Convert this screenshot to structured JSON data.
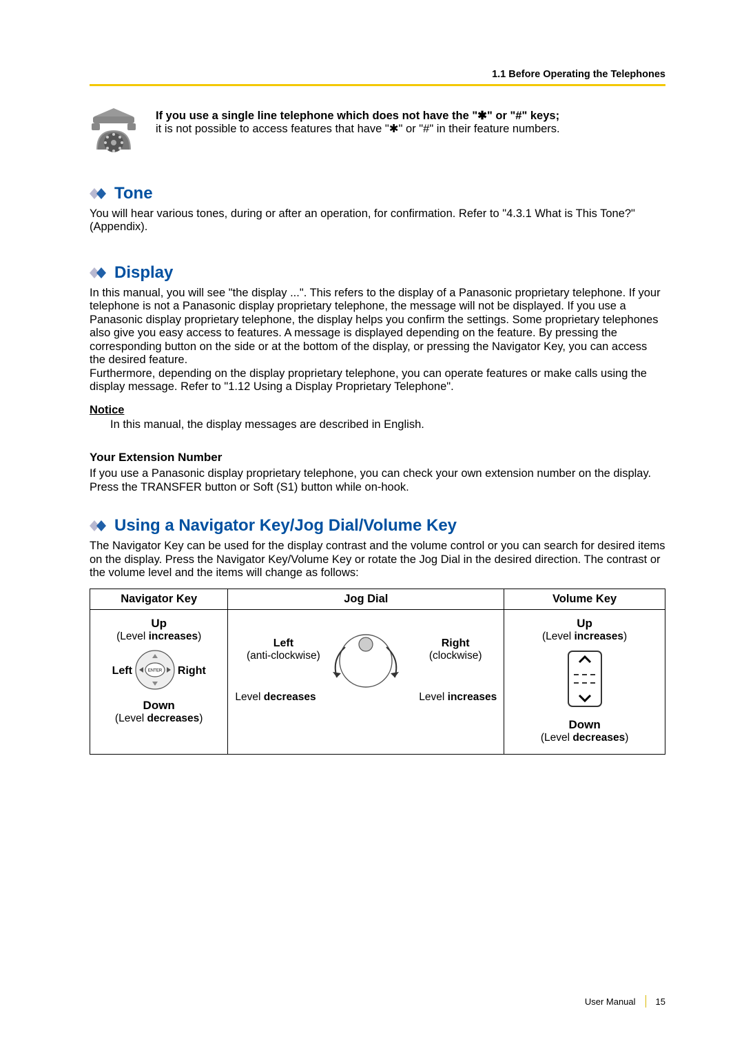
{
  "header": {
    "section_label": "1.1 Before Operating the Telephones"
  },
  "note": {
    "bold_line": "If you use a single line telephone which does not have the \"✱\" or \"#\" keys;",
    "plain_line": "it is not possible to access features that have \"✱\" or \"#\" in their feature numbers."
  },
  "sections": {
    "tone": {
      "title": "Tone",
      "body": "You will hear various tones, during or after an operation, for confirmation. Refer to \"4.3.1 What is This Tone?\" (Appendix)."
    },
    "display": {
      "title": "Display",
      "body": "In this manual, you will see \"the display ...\". This refers to the display of a Panasonic proprietary telephone. If your telephone is not a Panasonic display proprietary telephone, the message will not be displayed. If you use a Panasonic display proprietary telephone, the display helps you confirm the settings. Some proprietary telephones also give you easy access to features. A message is displayed depending on the feature. By pressing the corresponding button on the side or at the bottom of the display, or pressing the Navigator Key, you can access the desired feature.\nFurthermore, depending on the display proprietary telephone, you can operate features or make calls using the display message. Refer to \"1.12 Using a Display Proprietary Telephone\".",
      "notice_label": "Notice",
      "notice_body": "In this manual, the display messages are described in English.",
      "ext_head": "Your Extension Number",
      "ext_body": "If you use a Panasonic display proprietary telephone, you can check your own extension number on the display. Press the TRANSFER button or Soft (S1) button while on-hook."
    },
    "navigator": {
      "title": "Using a Navigator Key/Jog Dial/Volume Key",
      "body": "The Navigator Key can be used for the display contrast and the volume control or you can search for desired items on the display. Press the Navigator Key/Volume Key or rotate the Jog Dial in the desired direction. The contrast or the volume level and the items will change as follows:"
    }
  },
  "table": {
    "headers": [
      "Navigator Key",
      "Jog Dial",
      "Volume Key"
    ],
    "nav_cell": {
      "up": "Up",
      "up_paren_pre": "(Level ",
      "up_paren_bold": "increases",
      "up_paren_post": ")",
      "left": "Left",
      "right": "Right",
      "enter": "ENTER",
      "down": "Down",
      "down_paren_pre": "(Level ",
      "down_paren_bold": "decreases",
      "down_paren_post": ")"
    },
    "jog_cell": {
      "left": "Left",
      "left_sub": "(anti-clockwise)",
      "right": "Right",
      "right_sub": "(clockwise)",
      "level_dec_pre": "Level ",
      "level_dec_bold": "decreases",
      "level_inc_pre": "Level ",
      "level_inc_bold": "increases"
    },
    "vol_cell": {
      "up": "Up",
      "up_paren_pre": "(Level ",
      "up_paren_bold": "increases",
      "up_paren_post": ")",
      "down": "Down",
      "down_paren_pre": "(Level ",
      "down_paren_bold": "decreases",
      "down_paren_post": ")"
    }
  },
  "footer": {
    "label": "User Manual",
    "page": "15"
  }
}
